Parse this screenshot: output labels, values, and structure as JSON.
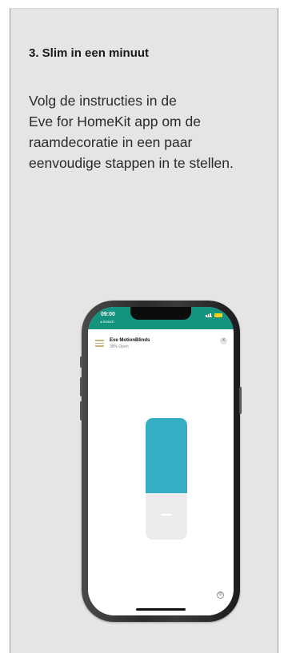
{
  "step": {
    "title": "3. Slim in een minuut",
    "body_lines": [
      "Volg de instructies in de",
      "Eve for HomeKit app om de",
      "raamdecoratie in een paar",
      "eenvoudige stappen in te stellen."
    ]
  },
  "phone": {
    "status_time": "09:00",
    "back_label": "◂ Search",
    "accessory_name": "Eve MotionBlinds",
    "accessory_status": "38% Open",
    "blind_open_percent": 38,
    "close_icon": "close-icon",
    "settings_icon": "gear-icon"
  },
  "colors": {
    "card_background": "#e5e5e5",
    "status_bar": "#14937e",
    "slider_fill": "#35aec3",
    "slider_track": "#ececec"
  }
}
